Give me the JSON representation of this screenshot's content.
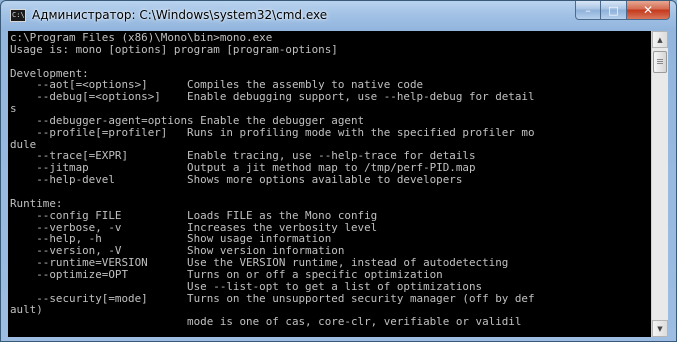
{
  "window": {
    "title": "Администратор: C:\\Windows\\system32\\cmd.exe",
    "app_icon_text": "C:\\",
    "minimize_glyph": "–",
    "maximize_glyph": "□",
    "close_glyph": "✕"
  },
  "console": {
    "lines": [
      "c:\\Program Files (x86)\\Mono\\bin>mono.exe",
      "Usage is: mono [options] program [program-options]",
      "",
      "Development:",
      "    --aot[=<options>]      Compiles the assembly to native code",
      "    --debug[=<options>]    Enable debugging support, use --help-debug for detail",
      "s",
      "    --debugger-agent=options Enable the debugger agent",
      "    --profile[=profiler]   Runs in profiling mode with the specified profiler mo",
      "dule",
      "    --trace[=EXPR]         Enable tracing, use --help-trace for details",
      "    --jitmap               Output a jit method map to /tmp/perf-PID.map",
      "    --help-devel           Shows more options available to developers",
      "",
      "Runtime:",
      "    --config FILE          Loads FILE as the Mono config",
      "    --verbose, -v          Increases the verbosity level",
      "    --help, -h             Show usage information",
      "    --version, -V          Show version information",
      "    --runtime=VERSION      Use the VERSION runtime, instead of autodetecting",
      "    --optimize=OPT         Turns on or off a specific optimization",
      "                           Use --list-opt to get a list of optimizations",
      "    --security[=mode]      Turns on the unsupported security manager (off by def",
      "ault)",
      "                           mode is one of cas, core-clr, verifiable or validil"
    ]
  },
  "scrollbar": {
    "up_glyph": "▲",
    "down_glyph": "▼"
  },
  "colors": {
    "console_bg": "#000000",
    "console_fg": "#c0c0c0",
    "close_button": "#c4381c"
  }
}
